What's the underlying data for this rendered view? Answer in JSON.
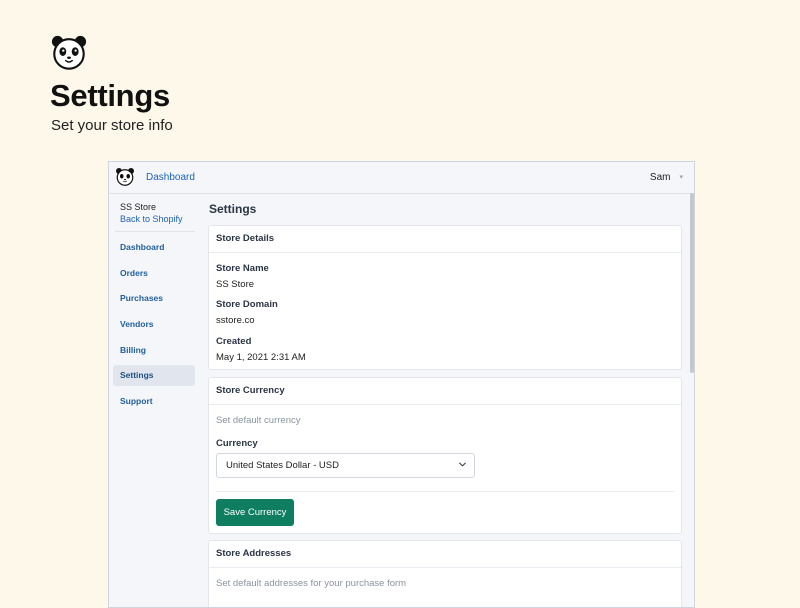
{
  "hero": {
    "title": "Settings",
    "subtitle": "Set your store info",
    "logo_icon": "panda-logo-icon"
  },
  "topbar": {
    "logo_icon": "panda-logo-icon",
    "dashboard_link": "Dashboard",
    "user_name": "Sam",
    "user_menu_icon": "chevron-down-icon"
  },
  "sidebar": {
    "store_name": "SS Store",
    "back_link": "Back to Shopify",
    "items": [
      {
        "label": "Dashboard",
        "active": false
      },
      {
        "label": "Orders",
        "active": false
      },
      {
        "label": "Purchases",
        "active": false
      },
      {
        "label": "Vendors",
        "active": false
      },
      {
        "label": "Billing",
        "active": false
      },
      {
        "label": "Settings",
        "active": true
      },
      {
        "label": "Support",
        "active": false
      }
    ]
  },
  "main": {
    "title": "Settings",
    "store_details": {
      "heading": "Store Details",
      "fields": [
        {
          "label": "Store Name",
          "value": "SS Store"
        },
        {
          "label": "Store Domain",
          "value": "sstore.co"
        },
        {
          "label": "Created",
          "value": "May 1, 2021 2:31 AM"
        }
      ]
    },
    "store_currency": {
      "heading": "Store Currency",
      "helper": "Set default currency",
      "field_label": "Currency",
      "selected": "United States Dollar - USD",
      "save_button": "Save Currency"
    },
    "store_addresses": {
      "heading": "Store Addresses",
      "helper": "Set default addresses for your purchase form"
    }
  },
  "colors": {
    "page_background": "#fdf8ea",
    "link": "#1e63b8",
    "primary_button": "#0f7d60",
    "app_background": "#f4f6fa"
  }
}
